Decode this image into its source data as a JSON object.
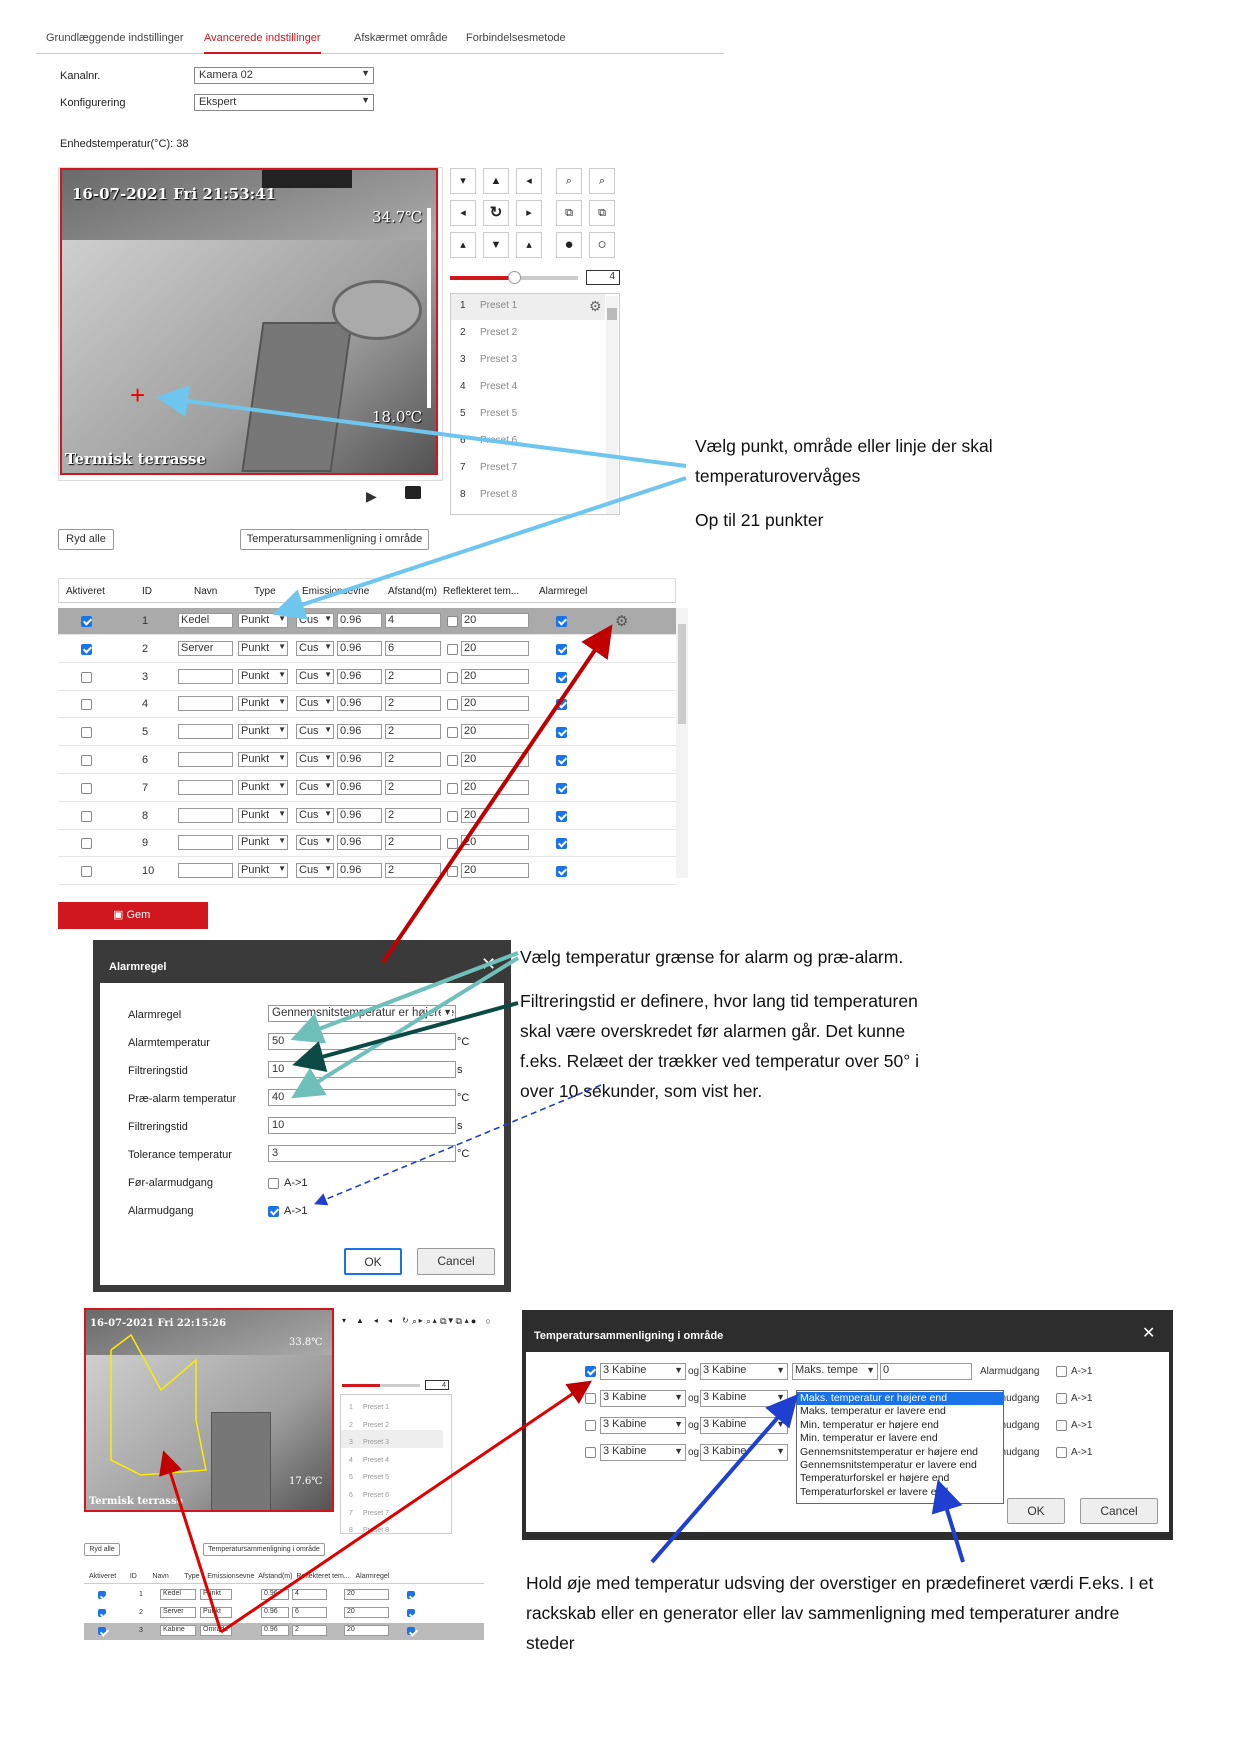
{
  "tabs": [
    "Grundlæggende indstillinger",
    "Avancerede indstillinger",
    "Afskærmet område",
    "Forbindelsesmetode"
  ],
  "active_tab": "Avancerede indstillinger",
  "form": {
    "channel_label": "Kanalnr.",
    "channel_value": "Kamera 02",
    "config_label": "Konfigurering",
    "config_value": "Ekspert",
    "device_temp": "Enhedstemperatur(°C): 38"
  },
  "video": {
    "timestamp": "16-07-2021 Fri 21:53:41",
    "max_temp": "34.7℃",
    "min_temp": "18.0℃",
    "caption": "Termisk terrasse"
  },
  "zoom_value": "4",
  "presets": [
    {
      "n": "1",
      "name": "Preset 1"
    },
    {
      "n": "2",
      "name": "Preset 2"
    },
    {
      "n": "3",
      "name": "Preset 3"
    },
    {
      "n": "4",
      "name": "Preset 4"
    },
    {
      "n": "5",
      "name": "Preset 5"
    },
    {
      "n": "6",
      "name": "Preset 6"
    },
    {
      "n": "7",
      "name": "Preset 7"
    },
    {
      "n": "8",
      "name": "Preset 8"
    }
  ],
  "buttons": {
    "clear_all": "Ryd alle",
    "temp_compare": "Temperatursammenligning i område",
    "save": "Gem",
    "ok": "OK",
    "cancel": "Cancel"
  },
  "table": {
    "headers": [
      "Aktiveret",
      "ID",
      "Navn",
      "Type",
      "Emissionsevne",
      "Afstand(m)",
      "Reflekteret tem...",
      "Alarmregel"
    ],
    "rows": [
      {
        "on": true,
        "id": "1",
        "name": "Kedel",
        "type": "Punkt",
        "em": "Cus",
        "ev": "0.96",
        "dist": "4",
        "refl": "20",
        "alarm": true
      },
      {
        "on": true,
        "id": "2",
        "name": "Server",
        "type": "Punkt",
        "em": "Cus",
        "ev": "0.96",
        "dist": "6",
        "refl": "20",
        "alarm": true
      },
      {
        "on": false,
        "id": "3",
        "name": "",
        "type": "Punkt",
        "em": "Cus",
        "ev": "0.96",
        "dist": "2",
        "refl": "20",
        "alarm": true
      },
      {
        "on": false,
        "id": "4",
        "name": "",
        "type": "Punkt",
        "em": "Cus",
        "ev": "0.96",
        "dist": "2",
        "refl": "20",
        "alarm": true
      },
      {
        "on": false,
        "id": "5",
        "name": "",
        "type": "Punkt",
        "em": "Cus",
        "ev": "0.96",
        "dist": "2",
        "refl": "20",
        "alarm": true
      },
      {
        "on": false,
        "id": "6",
        "name": "",
        "type": "Punkt",
        "em": "Cus",
        "ev": "0.96",
        "dist": "2",
        "refl": "20",
        "alarm": true
      },
      {
        "on": false,
        "id": "7",
        "name": "",
        "type": "Punkt",
        "em": "Cus",
        "ev": "0.96",
        "dist": "2",
        "refl": "20",
        "alarm": true
      },
      {
        "on": false,
        "id": "8",
        "name": "",
        "type": "Punkt",
        "em": "Cus",
        "ev": "0.96",
        "dist": "2",
        "refl": "20",
        "alarm": true
      },
      {
        "on": false,
        "id": "9",
        "name": "",
        "type": "Punkt",
        "em": "Cus",
        "ev": "0.96",
        "dist": "2",
        "refl": "20",
        "alarm": true
      },
      {
        "on": false,
        "id": "10",
        "name": "",
        "type": "Punkt",
        "em": "Cus",
        "ev": "0.96",
        "dist": "2",
        "refl": "20",
        "alarm": true
      }
    ]
  },
  "alarm_modal": {
    "title": "Alarmregel",
    "rows": [
      {
        "label": "Alarmregel",
        "value": "Gennemsnitstemperatur er højere end",
        "unit": ""
      },
      {
        "label": "Alarmtemperatur",
        "value": "50",
        "unit": "°C"
      },
      {
        "label": "Filtreringstid",
        "value": "10",
        "unit": "s"
      },
      {
        "label": "Præ-alarm temperatur",
        "value": "40",
        "unit": "°C"
      },
      {
        "label": "Filtreringstid",
        "value": "10",
        "unit": "s"
      },
      {
        "label": "Tolerance temperatur",
        "value": "3",
        "unit": "°C"
      }
    ],
    "pre_alarm_out_label": "Før-alarmudgang",
    "alarm_out_label": "Alarmudgang",
    "output": "A->1"
  },
  "small": {
    "timestamp": "16-07-2021 Fri 22:15:26",
    "max_temp": "33.8℃",
    "min_temp": "17.6℃",
    "caption": "Termisk terrasse",
    "zoom": "4",
    "presets": [
      "Preset 1",
      "Preset 2",
      "Preset 3",
      "Preset 4",
      "Preset 5",
      "Preset 6",
      "Preset 7",
      "Preset 8"
    ],
    "rows": [
      {
        "id": "1",
        "name": "Kedel",
        "type": "Punkt",
        "ev": "0.96",
        "dist": "4",
        "refl": "20"
      },
      {
        "id": "2",
        "name": "Server",
        "type": "Punkt",
        "ev": "0.96",
        "dist": "6",
        "refl": "20"
      },
      {
        "id": "3",
        "name": "Kabine",
        "type": "Område",
        "ev": "0.96",
        "dist": "2",
        "refl": "20"
      }
    ]
  },
  "compare_modal": {
    "title": "Temperatursammenligning i område",
    "sel_a": "3 Kabine",
    "og": "og",
    "sel_b": "3 Kabine",
    "rule": "Maks. tempe",
    "value": "0",
    "alarm_out": "Alarmudgang",
    "output": "A->1",
    "options": [
      "Maks. temperatur er højere end",
      "Maks. temperatur er lavere end",
      "Min. temperatur er højere end",
      "Min. temperatur er lavere end",
      "Gennemsnitstemperatur er højere end",
      "Gennemsnitstemperatur er lavere end",
      "Temperaturforskel er højere end",
      "Temperaturforskel er lavere end"
    ]
  },
  "annotations": {
    "a1": "Vælg punkt, område eller linje der skal temperaturovervåges",
    "a2": "Op til 21 punkter",
    "a3": "Vælg temperatur grænse for alarm og præ-alarm.",
    "a4": "Filtreringstid er definere, hvor lang tid temperaturen skal være overskredet før alarmen går. Det kunne f.eks. Relæet der trækker ved temperatur over 50° i over 10 sekunder, som vist her.",
    "a5": "Hold øje med temperatur udsving der overstiger en prædefineret værdi F.eks. I et rackskab eller en generator eller lav sammenligning med temperaturer andre steder"
  }
}
